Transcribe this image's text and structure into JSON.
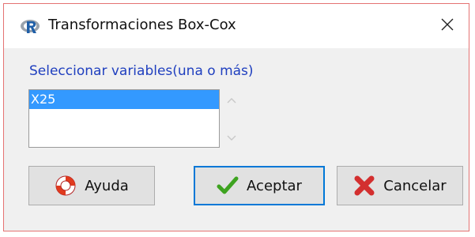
{
  "window": {
    "title": "Transformaciones Box-Cox",
    "app_icon": "r-logo-icon",
    "close_icon": "close-icon"
  },
  "variables": {
    "label": "Seleccionar variables(una o más)",
    "items": [
      {
        "label": "X25",
        "selected": true
      },
      {
        "label": "",
        "selected": false
      },
      {
        "label": "",
        "selected": false
      }
    ]
  },
  "buttons": {
    "help_label": "Ayuda",
    "ok_label": "Aceptar",
    "cancel_label": "Cancelar"
  },
  "colors": {
    "label_text": "#1f3fbf",
    "selection": "#3399ff",
    "window_border": "#e57373",
    "focus_border": "#0078d7"
  }
}
